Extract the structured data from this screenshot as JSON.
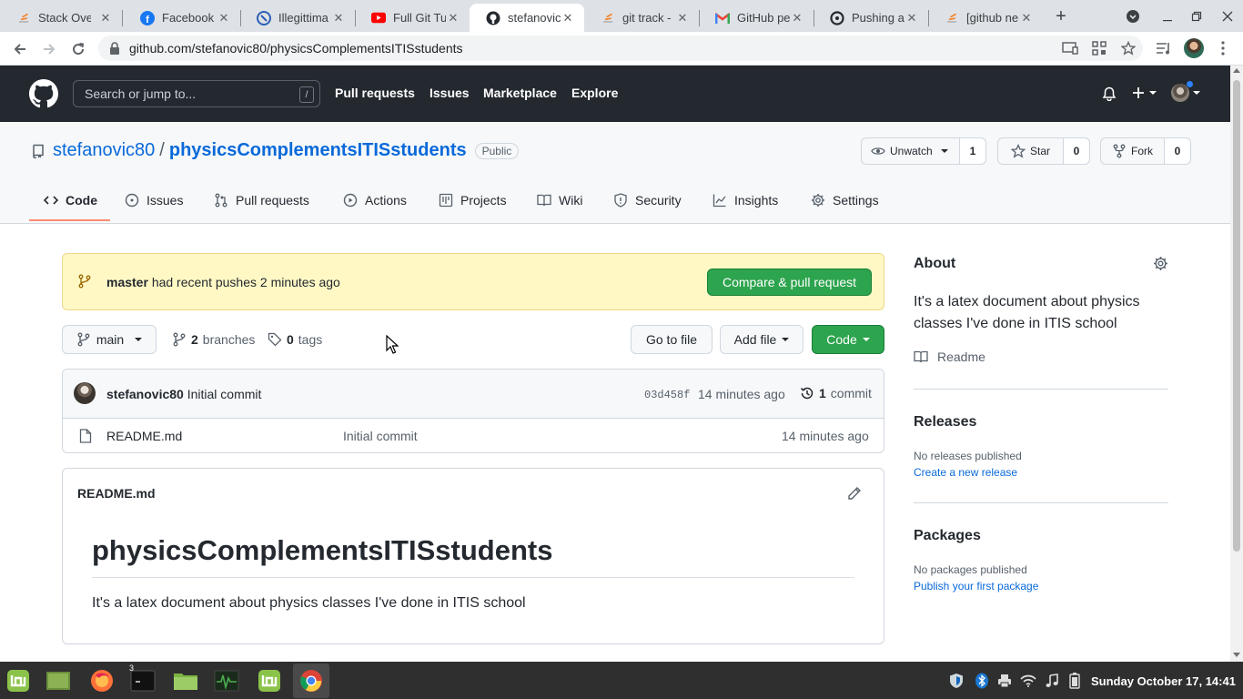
{
  "browser": {
    "tabs": [
      {
        "title": "Stack Overflow",
        "icon": "stackoverflow-icon"
      },
      {
        "title": "Facebook",
        "icon": "facebook-icon"
      },
      {
        "title": "Illegittima",
        "icon": "site-icon"
      },
      {
        "title": "Full Git Tutorial",
        "icon": "youtube-icon"
      },
      {
        "title": "stefanovic",
        "icon": "github-icon"
      },
      {
        "title": "git track - ",
        "icon": "stackoverflow-icon"
      },
      {
        "title": "GitHub pe",
        "icon": "gmail-icon"
      },
      {
        "title": "Pushing a ",
        "icon": "site-icon"
      },
      {
        "title": "[github ne",
        "icon": "stackoverflow-icon"
      }
    ],
    "url": "github.com/stefanovic80/physicsComplementsITISstudents"
  },
  "github_header": {
    "search_placeholder": "Search or jump to...",
    "slash_hint": "/",
    "nav": [
      "Pull requests",
      "Issues",
      "Marketplace",
      "Explore"
    ]
  },
  "repo": {
    "owner": "stefanovic80",
    "separator": "/",
    "name": "physicsComplementsITISstudents",
    "visibility": "Public",
    "unwatch_label": "Unwatch",
    "watch_count": "1",
    "star_label": "Star",
    "star_count": "0",
    "fork_label": "Fork",
    "fork_count": "0",
    "tabs": [
      "Code",
      "Issues",
      "Pull requests",
      "Actions",
      "Projects",
      "Wiki",
      "Security",
      "Insights",
      "Settings"
    ]
  },
  "banner": {
    "branch": "master",
    "message": "had recent pushes 2 minutes ago",
    "compare_label": "Compare & pull request"
  },
  "file_nav": {
    "branch": "main",
    "branches_count": "2",
    "branches_label": "branches",
    "tags_count": "0",
    "tags_label": "tags",
    "goto_label": "Go to file",
    "addfile_label": "Add file",
    "code_label": "Code"
  },
  "commit": {
    "author": "stefanovic80",
    "message": "Initial commit",
    "sha": "03d458f",
    "time": "14 minutes ago",
    "count": "1",
    "count_label": "commit"
  },
  "files": [
    {
      "name": "README.md",
      "message": "Initial commit",
      "time": "14 minutes ago"
    }
  ],
  "readme": {
    "filename": "README.md",
    "heading": "physicsComplementsITISstudents",
    "body": "It's a latex document about physics classes I've done in ITIS school"
  },
  "sidebar": {
    "about_title": "About",
    "about_text": "It's a latex document about physics classes I've done in ITIS school",
    "readme_label": "Readme",
    "releases_title": "Releases",
    "releases_none": "No releases published",
    "releases_link": "Create a new release",
    "packages_title": "Packages",
    "packages_none": "No packages published",
    "packages_link": "Publish your first package"
  },
  "taskbar": {
    "terminal_badge": "3",
    "clock": "Sunday October 17, 14:41"
  }
}
